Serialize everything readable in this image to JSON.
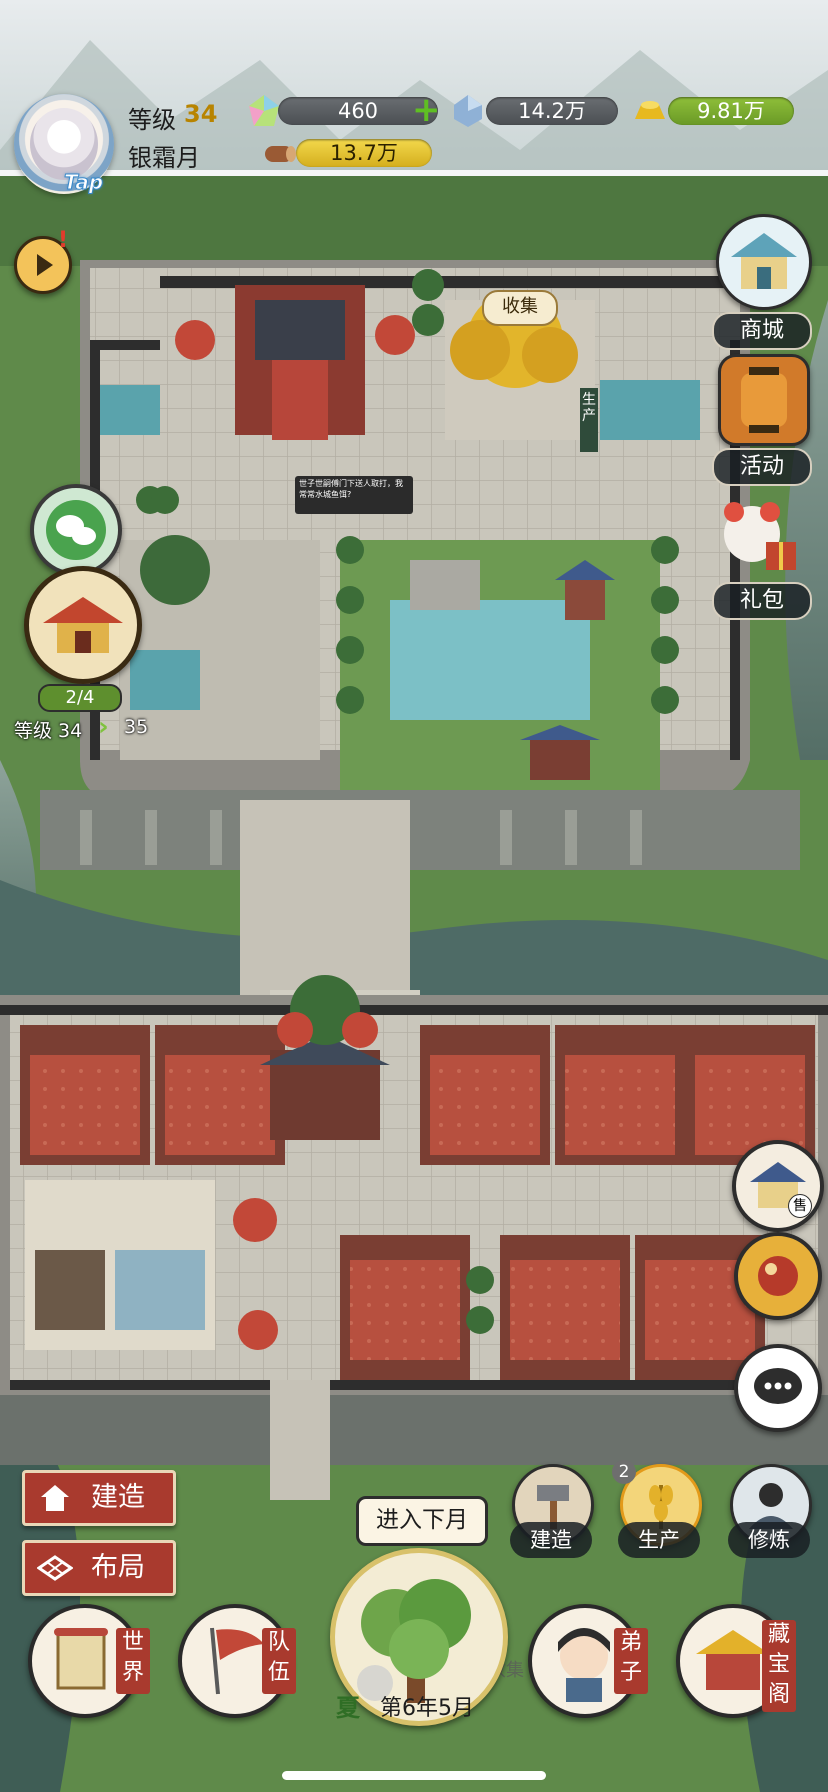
{
  "player": {
    "level_label": "等级",
    "level_value": "34",
    "name": "银霜月",
    "avatar_badge": "Tap"
  },
  "resources": {
    "jade": "460",
    "crystal": "14.2万",
    "gold": "9.81万",
    "wood": "13.7万"
  },
  "map": {
    "collect_label": "收集",
    "produce_label": "生产",
    "speech_text": "世子世嗣傅门下送人取打，我常常水城鱼饵?",
    "collect_label_2": "收集"
  },
  "right_menu": {
    "shop": "商城",
    "event": "活动",
    "gift": "礼包"
  },
  "left_menu": {
    "building_progress": "2/4",
    "level_from": "等级 34",
    "level_arrow": "›",
    "level_to": "35"
  },
  "bottom_left": {
    "build": "建造",
    "layout": "布局"
  },
  "bottom_mid": {
    "build": "建造",
    "produce": "生产",
    "produce_badge": "2",
    "cultivate": "修炼",
    "next_month": "进入下月",
    "season": "夏",
    "date": "第6年5月"
  },
  "bottom_nav": {
    "world": "世界",
    "team": "队伍",
    "disciple": "弟子",
    "treasury": "藏宝阁"
  },
  "side_sell_badge": "售",
  "colors": {
    "red_button": "#a93a2e",
    "gold": "#d4ae1e",
    "grass": "#5f8a4a",
    "roof": "#3f4a5a"
  }
}
